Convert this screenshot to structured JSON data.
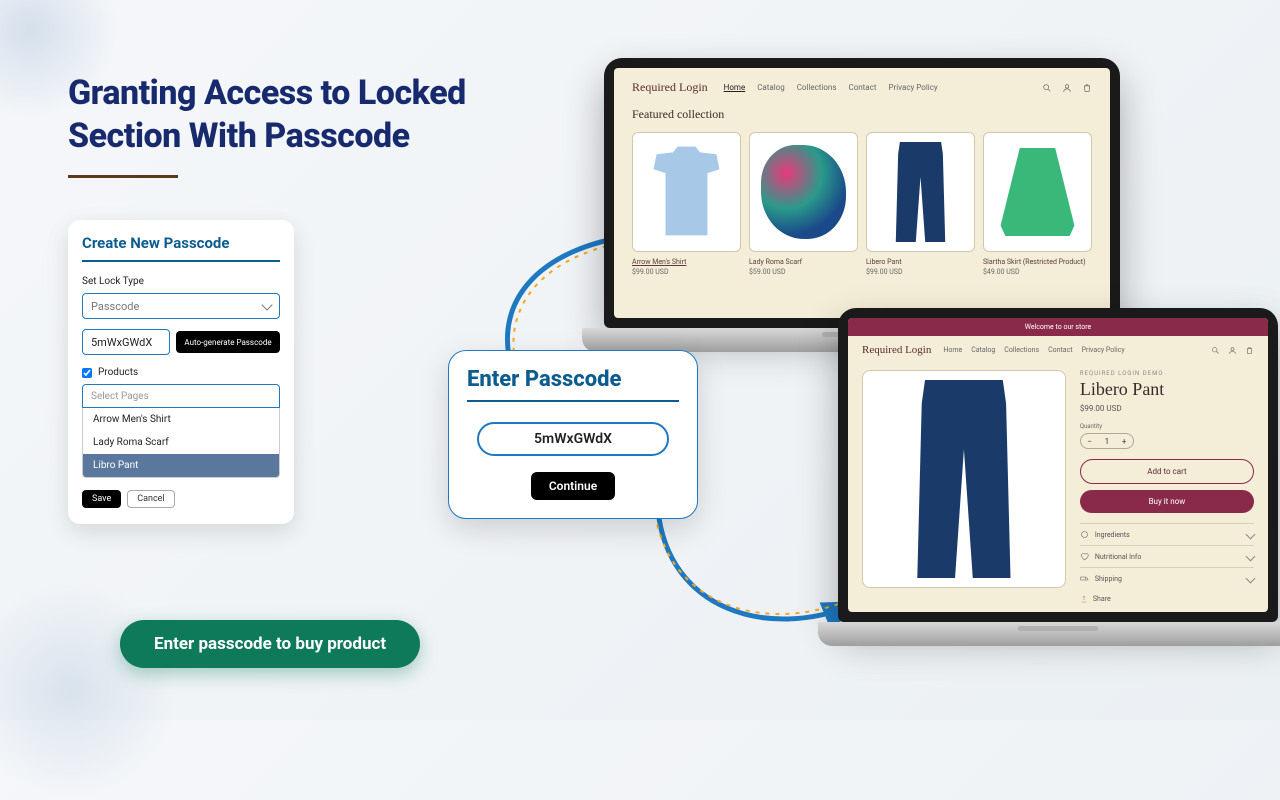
{
  "headline": {
    "line1": "Granting Access to Locked",
    "line2": "Section With Passcode"
  },
  "create": {
    "title": "Create New Passcode",
    "lockTypeLabel": "Set Lock Type",
    "lockTypeValue": "Passcode",
    "codeValue": "5mWxGWdX",
    "autoBtn": "Auto-generate Passcode",
    "productsCheck": "Products",
    "selectPlaceholder": "Select Pages",
    "options": {
      "o1": "Arrow Men's Shirt",
      "o2": "Lady Roma Scarf",
      "o3": "Libro Pant"
    },
    "save": "Save",
    "cancel": "Cancel"
  },
  "enter": {
    "title": "Enter Passcode",
    "value": "5mWxGWdX",
    "continue": "Continue"
  },
  "cta": "Enter passcode to buy product",
  "store": {
    "brand": "Required Login",
    "nav": {
      "home": "Home",
      "catalog": "Catalog",
      "collections": "Collections",
      "contact": "Contact",
      "privacy": "Privacy Policy"
    },
    "featured": "Featured collection",
    "products": {
      "p1": {
        "name": "Arrow Men's Shirt",
        "price": "$99.00 USD"
      },
      "p2": {
        "name": "Lady Roma Scarf",
        "price": "$59.00 USD"
      },
      "p3": {
        "name": "Libero Pant",
        "price": "$99.00 USD"
      },
      "p4": {
        "name": "Slartha Skirt (Restricted Product)",
        "price": "$49.00 USD"
      }
    }
  },
  "pdp": {
    "banner": "Welcome to our store",
    "brandLabel": "Required Login Demo",
    "title": "Libero Pant",
    "price": "$99.00 USD",
    "qtyLabel": "Quantity",
    "qty": "1",
    "addToCart": "Add to cart",
    "buyNow": "Buy it now",
    "acc": {
      "a1": "Ingredients",
      "a2": "Nutritional Info",
      "a3": "Shipping"
    },
    "share": "Share"
  }
}
